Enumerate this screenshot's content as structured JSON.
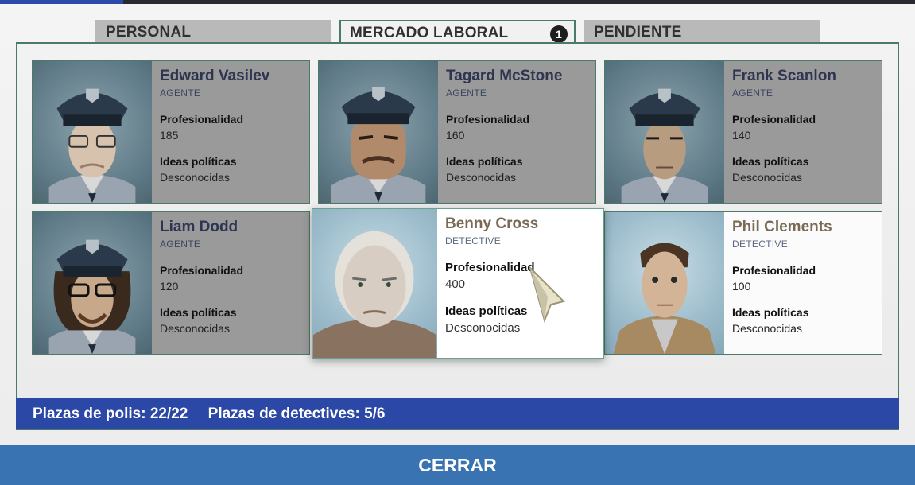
{
  "tabs": [
    {
      "label": "PERSONAL",
      "active": false
    },
    {
      "label": "MERCADO LABORAL",
      "active": true,
      "badge": "1"
    },
    {
      "label": "PENDIENTE",
      "active": false
    }
  ],
  "labels": {
    "professionalism": "Profesionalidad",
    "politics": "Ideas políticas"
  },
  "candidates": [
    {
      "name": "Edward Vasilev",
      "rank": "AGENTE",
      "professionalism": "185",
      "politics": "Desconocidas"
    },
    {
      "name": "Tagard McStone",
      "rank": "AGENTE",
      "professionalism": "160",
      "politics": "Desconocidas"
    },
    {
      "name": "Frank Scanlon",
      "rank": "AGENTE",
      "professionalism": "140",
      "politics": "Desconocidas"
    },
    {
      "name": "Liam Dodd",
      "rank": "AGENTE",
      "professionalism": "120",
      "politics": "Desconocidas"
    },
    {
      "name": "Benny Cross",
      "rank": "DETECTIVE",
      "professionalism": "400",
      "politics": "Desconocidas"
    },
    {
      "name": "Phil Clements",
      "rank": "DETECTIVE",
      "professionalism": "100",
      "politics": "Desconocidas"
    }
  ],
  "status": {
    "police_slots": "Plazas de polis: 22/22",
    "detective_slots": "Plazas de detectives: 5/6"
  },
  "close_label": "CERRAR",
  "colors": {
    "accent_blue": "#2b48a6",
    "close_blue": "#3a73b2",
    "tab_border": "#4a7a6a"
  }
}
